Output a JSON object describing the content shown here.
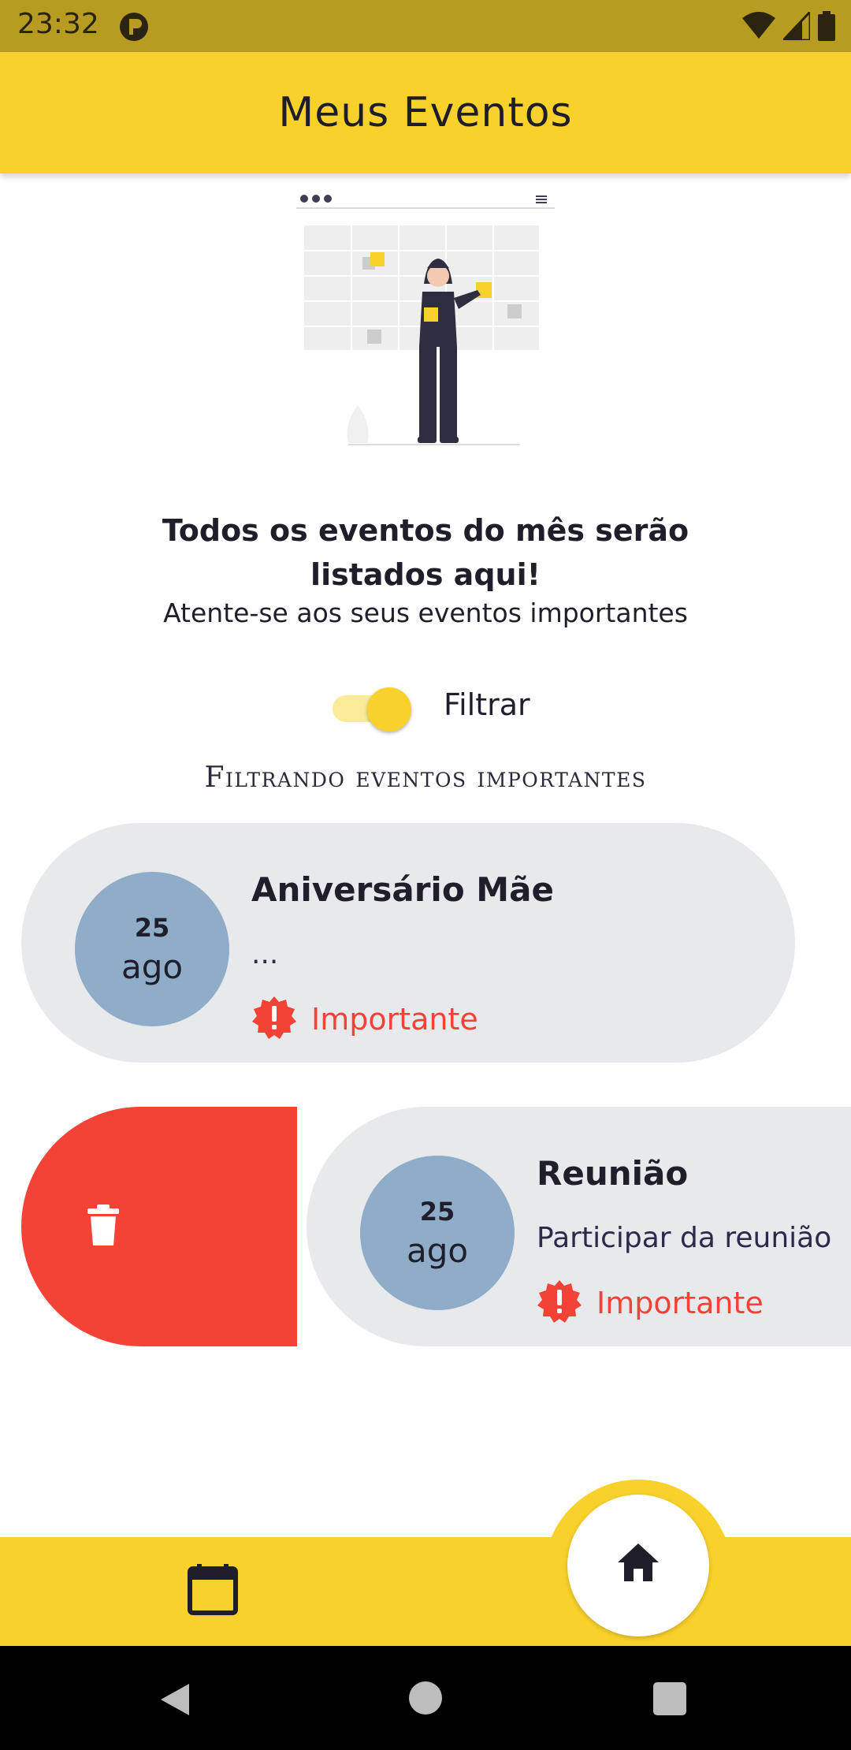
{
  "status_bar": {
    "time": "23:32"
  },
  "app_bar": {
    "title": "Meus Eventos"
  },
  "intro": {
    "headline": "Todos os eventos do mês serão listados aqui!",
    "subline": "Atente-se aos seus eventos importantes"
  },
  "filter": {
    "enabled": true,
    "label": "Filtrar",
    "caption": "Filtrando eventos importantes"
  },
  "events": [
    {
      "day": "25",
      "month": "ago",
      "title": "Aniversário Mãe",
      "description": "...",
      "badge": "Importante"
    },
    {
      "day": "25",
      "month": "ago",
      "title": "Reunião",
      "description": "Participar da reunião",
      "badge": "Importante"
    }
  ],
  "colors": {
    "accent": "#f9d12b",
    "danger": "#f44336",
    "card": "#e8e9ec",
    "date_circle": "#8fadc8"
  },
  "icons": {
    "status": [
      "app-notification-icon",
      "wifi-icon",
      "signal-icon",
      "battery-icon"
    ],
    "delete": "trash-icon",
    "badge": "alert-badge-icon",
    "bottom_nav": [
      "calendar-icon",
      "home-icon"
    ]
  }
}
